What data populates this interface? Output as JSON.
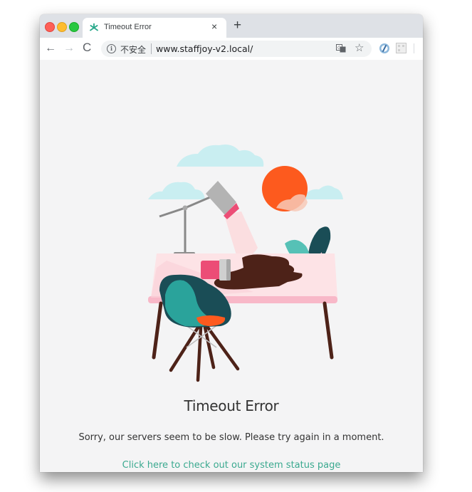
{
  "browser": {
    "tab": {
      "title": "Timeout Error",
      "close_glyph": "×",
      "favicon": "staffjoy-logo-icon"
    },
    "new_tab_glyph": "+",
    "toolbar": {
      "back_glyph": "←",
      "forward_glyph": "→",
      "reload_glyph": "C",
      "info_glyph": "i",
      "security_text": "不安全",
      "url": "www.staffjoy-v2.local/",
      "star_glyph": "☆"
    }
  },
  "page": {
    "heading": "Timeout Error",
    "message": "Sorry, our servers seem to be slow. Please try again in a moment.",
    "link_text": "Click here to check out our system status page"
  },
  "colors": {
    "link": "#3aa98f",
    "sun": "#fd5a1e",
    "desk_top": "#fde3e6",
    "chair": "#2aa39b",
    "coffee": "#4d2218",
    "cloud": "#c9eef1"
  }
}
